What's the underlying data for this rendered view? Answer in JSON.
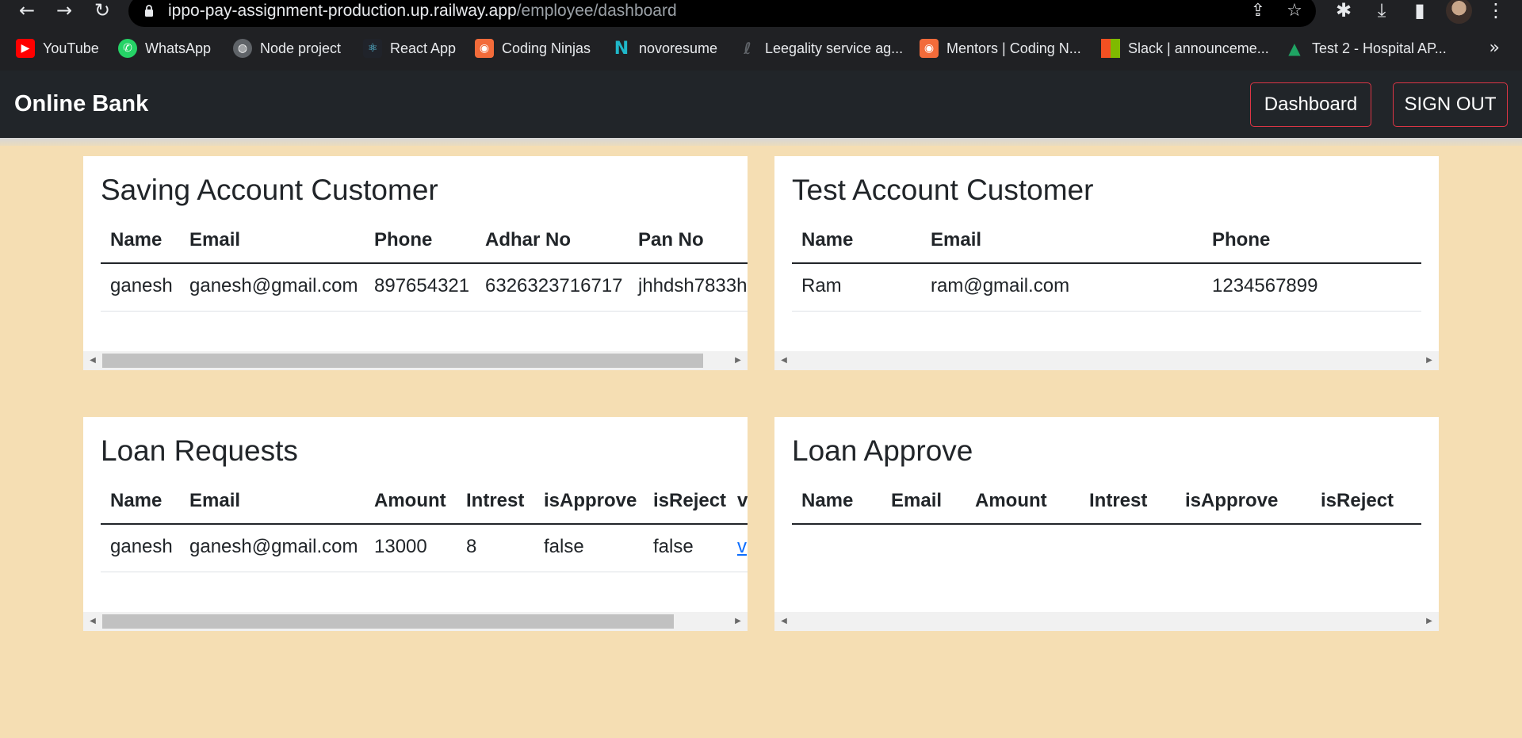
{
  "browser": {
    "url_host": "ippo-pay-assignment-production.up.railway.app",
    "url_path": "/employee/dashboard",
    "bookmarks": [
      {
        "label": "YouTube",
        "icon": "youtube-icon",
        "color": "#ff0000"
      },
      {
        "label": "WhatsApp",
        "icon": "whatsapp-icon",
        "color": "#25d366"
      },
      {
        "label": "Node project",
        "icon": "globe-icon",
        "color": "#5f6368"
      },
      {
        "label": "React App",
        "icon": "react-icon",
        "color": "#61dafb"
      },
      {
        "label": "Coding Ninjas",
        "icon": "coding-ninjas-icon",
        "color": "#f26b3a"
      },
      {
        "label": "novoresume",
        "icon": "novoresume-icon",
        "color": "#1fb7c9"
      },
      {
        "label": "Leegality service ag...",
        "icon": "leegality-icon",
        "color": "#5f6368"
      },
      {
        "label": "Mentors | Coding N...",
        "icon": "coding-ninjas-icon",
        "color": "#f26b3a"
      },
      {
        "label": "Slack | announceme...",
        "icon": "microsoft-icon",
        "color": "#f25022"
      },
      {
        "label": "Test 2 - Hospital AP...",
        "icon": "google-drive-icon",
        "color": "#1fa463"
      }
    ],
    "more_bookmarks": "»"
  },
  "nav": {
    "brand": "Online Bank",
    "dashboard_label": "Dashboard",
    "signout_label": "SIGN OUT"
  },
  "saving": {
    "title": "Saving Account Customer",
    "headers": [
      "Name",
      "Email",
      "Phone",
      "Adhar No",
      "Pan No"
    ],
    "rows": [
      [
        "ganesh",
        "ganesh@gmail.com",
        "897654321",
        "6326323716717",
        "jhhdsh7833h"
      ]
    ]
  },
  "test": {
    "title": "Test Account Customer",
    "headers": [
      "Name",
      "Email",
      "Phone"
    ],
    "rows": [
      [
        "Ram",
        "ram@gmail.com",
        "1234567899"
      ]
    ]
  },
  "loan_requests": {
    "title": "Loan Requests",
    "headers": [
      "Name",
      "Email",
      "Amount",
      "Intrest",
      "isApprove",
      "isReject",
      "v"
    ],
    "rows": [
      [
        "ganesh",
        "ganesh@gmail.com",
        "13000",
        "8",
        "false",
        "false",
        "v"
      ]
    ]
  },
  "loan_approve": {
    "title": "Loan Approve",
    "headers": [
      "Name",
      "Email",
      "Amount",
      "Intrest",
      "isApprove",
      "isReject"
    ],
    "rows": []
  },
  "colors": {
    "page_bg": "#f5deb3",
    "navbar_bg": "#212529",
    "outline_button_border": "#dc3545",
    "link": "#0d6efd"
  }
}
